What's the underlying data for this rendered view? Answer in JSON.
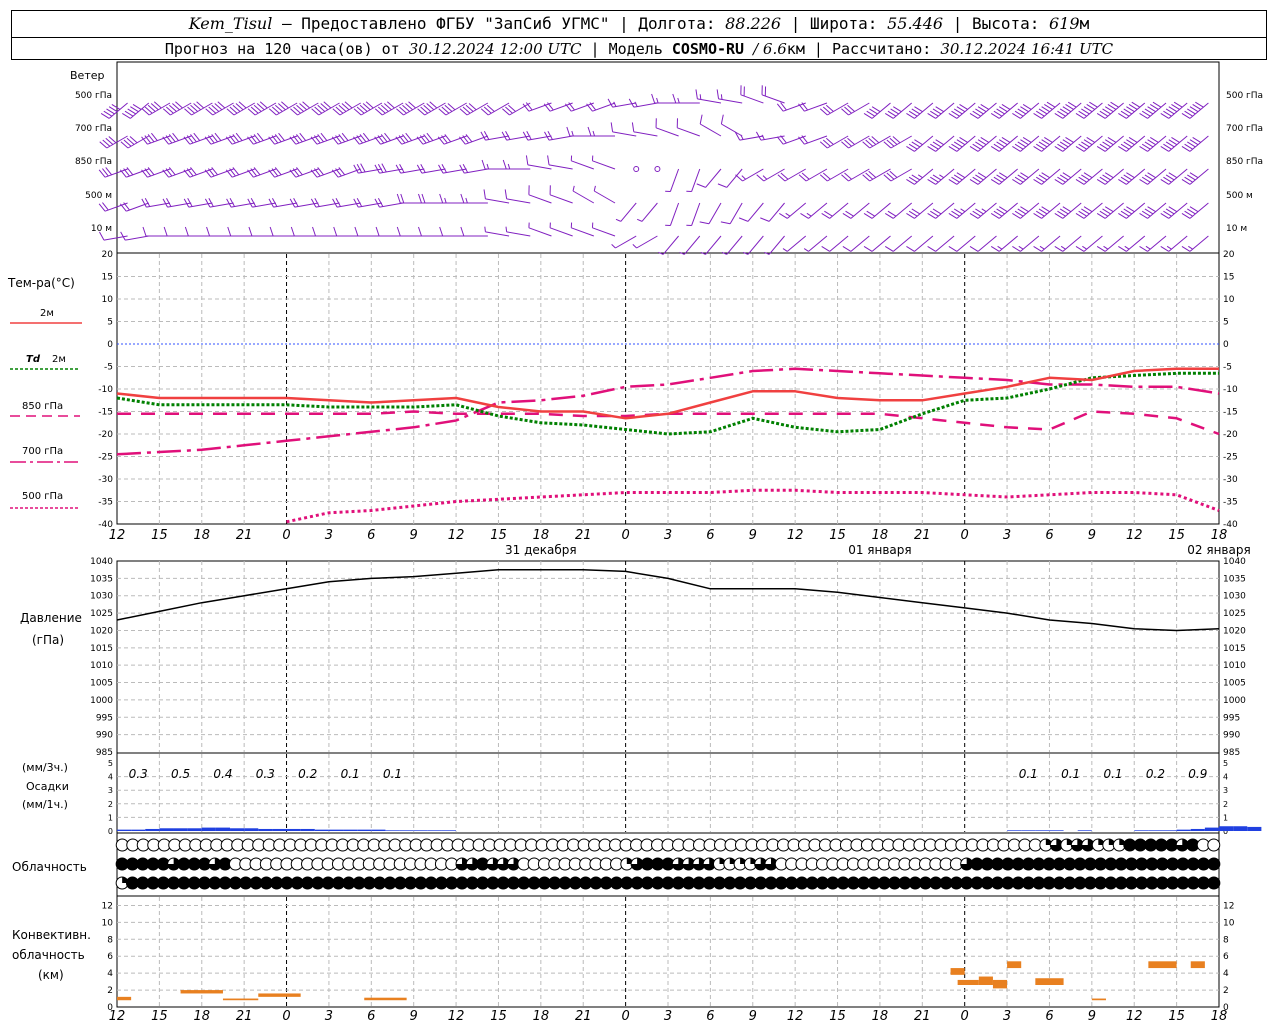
{
  "header": {
    "station": "Kem_Tisul",
    "provider": "— Предоставлено ФГБУ \"ЗапСиб УГМС\"",
    "lon_label": "| Долгота:",
    "lon": "88.226",
    "lat_label": "| Широта:",
    "lat": "55.446",
    "alt_label": "| Высота:",
    "alt": "619",
    "alt_unit": "м",
    "forecast_label": "Прогноз на 120 часа(ов) от",
    "init_time": "30.12.2024 12:00 UTC",
    "model_label": "| Модель",
    "model": "COSMO-RU",
    "resolution": "/ 6.6",
    "res_unit": "км |",
    "calc_label": "Рассчитано:",
    "calc_time": "30.12.2024 16:41 UTC"
  },
  "labels": {
    "wind": "Ветер",
    "wind_levels": [
      "500 гПа",
      "700 гПа",
      "850 гПа",
      "500 м",
      "10 м"
    ],
    "temp_title": "Тем-ра(°С)",
    "t2m": "2м",
    "td_sym": "Td",
    "td_lvl": "2м",
    "t850": "850 гПа",
    "t700": "700 гПа",
    "t500": "500 гПа",
    "pressure": "Давление",
    "pressure_unit": "(гПа)",
    "precip_3h": "(мм/3ч.)",
    "precip": "Осадки",
    "precip_1h": "(мм/1ч.)",
    "clouds": "Облачность",
    "conv1": "Конвективн.",
    "conv2": "облачность",
    "conv3": "(км)"
  },
  "x_ticks": [
    "12",
    "15",
    "18",
    "21",
    "0",
    "3",
    "6",
    "9",
    "12",
    "15",
    "18",
    "21",
    "0",
    "3",
    "6",
    "9",
    "12",
    "15",
    "18",
    "21",
    "0",
    "3",
    "6",
    "9",
    "12",
    "15",
    "18"
  ],
  "day_labels": [
    {
      "hour": 24,
      "text": "31 декабря"
    },
    {
      "hour": 48,
      "text": "01 января"
    },
    {
      "hour": 72,
      "text": "02 января"
    }
  ],
  "colors": {
    "t2m": "#f04040",
    "td2m": "#008000",
    "t850": "#e0107a",
    "t700": "#e0107a",
    "t500": "#e0107a",
    "wind": "#8020c0",
    "precip": "#2040e0",
    "conv": "#e88020",
    "zero": "#3050ff"
  },
  "chart_data": [
    {
      "type": "line",
      "panel": "temperature",
      "ylim": [
        -40,
        20
      ],
      "y_ticks": [
        20,
        15,
        10,
        5,
        0,
        -5,
        -10,
        -15,
        -20,
        -25,
        -30,
        -35,
        -40
      ],
      "hours": [
        0,
        3,
        6,
        9,
        12,
        15,
        18,
        21,
        24,
        27,
        30,
        33,
        36,
        39,
        42,
        45,
        48,
        51,
        54,
        57,
        60,
        63,
        66,
        69,
        72,
        75,
        78
      ],
      "series": [
        {
          "name": "2м",
          "values": [
            -11,
            -12,
            -12,
            -12,
            -12,
            -12.5,
            -13,
            -12.5,
            -12,
            -14,
            -15,
            -15,
            -16.5,
            -15.5,
            -13,
            -10.5,
            -10.5,
            -12,
            -12.5,
            -12.5,
            -11,
            -9.5,
            -7.5,
            -8,
            -6,
            -5.5,
            -5.5
          ]
        },
        {
          "name": "Td 2м",
          "values": [
            -12,
            -13.5,
            -13.5,
            -13.5,
            -13.5,
            -14,
            -14,
            -14,
            -13.5,
            -16,
            -17.5,
            -18,
            -19,
            -20,
            -19.5,
            -16.5,
            -18.5,
            -19.5,
            -19,
            -15.5,
            -12.5,
            -12,
            -10,
            -7.5,
            -7,
            -6.5,
            -6.5
          ]
        },
        {
          "name": "850 гПа",
          "values": [
            -15.5,
            -15.5,
            -15.5,
            -15.5,
            -15.5,
            -15.5,
            -15.5,
            -15,
            -15.5,
            -15.5,
            -15.5,
            -16,
            -16,
            -15.5,
            -15.5,
            -15.5,
            -15.5,
            -15.5,
            -15.5,
            -16.5,
            -17.5,
            -18.5,
            -19,
            -15,
            -15.5,
            -16.5,
            -20
          ]
        },
        {
          "name": "700 гПа",
          "values": [
            -24.5,
            -24,
            -23.5,
            -22.5,
            -21.5,
            -20.5,
            -19.5,
            -18.5,
            -17,
            -13,
            -12.5,
            -11.5,
            -9.5,
            -9,
            -7.5,
            -6,
            -5.5,
            -6,
            -6.5,
            -7,
            -7.5,
            -8,
            -9,
            -9,
            -9.5,
            -9.5,
            -11
          ]
        },
        {
          "name": "500 гПа",
          "values": [
            null,
            null,
            null,
            null,
            -39.5,
            -37.5,
            -37,
            -36,
            -35,
            -34.5,
            -34,
            -33.5,
            -33,
            -33,
            -33,
            -32.5,
            -32.5,
            -33,
            -33,
            -33,
            -33.5,
            -34,
            -33.5,
            -33,
            -33,
            -33.5,
            -37
          ]
        }
      ]
    },
    {
      "type": "line",
      "panel": "pressure",
      "ylim": [
        985,
        1040
      ],
      "y_ticks": [
        1040,
        1035,
        1030,
        1025,
        1020,
        1015,
        1010,
        1005,
        1000,
        995,
        990,
        985
      ],
      "hours": [
        0,
        3,
        6,
        9,
        12,
        15,
        18,
        21,
        24,
        27,
        30,
        33,
        36,
        39,
        42,
        45,
        48,
        51,
        54,
        57,
        60,
        63,
        66,
        69,
        72,
        75,
        78
      ],
      "series": [
        {
          "name": "Давление",
          "values": [
            1023,
            1025.5,
            1028,
            1030,
            1032,
            1034,
            1035,
            1035.5,
            1036.5,
            1037.5,
            1037.5,
            1037.5,
            1037,
            1035,
            1032,
            1032,
            1032,
            1031,
            1029.5,
            1028,
            1026.5,
            1025,
            1023,
            1022,
            1020.5,
            1020,
            1020.5
          ]
        }
      ]
    },
    {
      "type": "bar",
      "panel": "precipitation",
      "ylim": [
        0,
        5
      ],
      "y_ticks": [
        5,
        4,
        3,
        2,
        1,
        0
      ],
      "labels_3h": [
        {
          "hour": 1.5,
          "text": "0.3"
        },
        {
          "hour": 4.5,
          "text": "0.5"
        },
        {
          "hour": 7.5,
          "text": "0.4"
        },
        {
          "hour": 10.5,
          "text": "0.3"
        },
        {
          "hour": 13.5,
          "text": "0.2"
        },
        {
          "hour": 16.5,
          "text": "0.1"
        },
        {
          "hour": 19.5,
          "text": "0.1"
        },
        {
          "hour": 64.5,
          "text": "0.1"
        },
        {
          "hour": 67.5,
          "text": "0.1"
        },
        {
          "hour": 70.5,
          "text": "0.1"
        },
        {
          "hour": 73.5,
          "text": "0.2"
        },
        {
          "hour": 76.5,
          "text": "0.9"
        }
      ],
      "hourly": [
        0.1,
        0.1,
        0.15,
        0.2,
        0.2,
        0.2,
        0.25,
        0.25,
        0.2,
        0.2,
        0.15,
        0.15,
        0.15,
        0.15,
        0.1,
        0.1,
        0.1,
        0.1,
        0.1,
        0.05,
        0.05,
        0.05,
        0.05,
        0.05,
        0,
        0,
        0,
        0,
        0,
        0,
        0,
        0,
        0,
        0,
        0,
        0,
        0,
        0,
        0,
        0,
        0,
        0,
        0,
        0,
        0,
        0,
        0,
        0,
        0,
        0,
        0,
        0,
        0,
        0,
        0,
        0,
        0,
        0,
        0,
        0,
        0,
        0,
        0,
        0.05,
        0.05,
        0.05,
        0.05,
        0,
        0.05,
        0,
        0,
        0,
        0.05,
        0.05,
        0.05,
        0.1,
        0.15,
        0.25,
        0.35,
        0.35,
        0.3
      ]
    },
    {
      "type": "bar",
      "panel": "convective_clouds",
      "ylim": [
        0,
        13
      ],
      "y_ticks": [
        12,
        10,
        8,
        6,
        4,
        2,
        0
      ],
      "segments": [
        {
          "h0": 0,
          "h1": 1,
          "base": 0.8,
          "top": 1.2
        },
        {
          "h0": 4.5,
          "h1": 7.5,
          "base": 1.6,
          "top": 2.0
        },
        {
          "h0": 7.5,
          "h1": 10,
          "base": 0.8,
          "top": 1.0
        },
        {
          "h0": 10,
          "h1": 13,
          "base": 1.2,
          "top": 1.6
        },
        {
          "h0": 17.5,
          "h1": 20.5,
          "base": 0.8,
          "top": 1.1
        },
        {
          "h0": 59,
          "h1": 60,
          "base": 3.8,
          "top": 4.6
        },
        {
          "h0": 59.5,
          "h1": 61,
          "base": 2.6,
          "top": 3.2
        },
        {
          "h0": 61,
          "h1": 62,
          "base": 2.6,
          "top": 3.6
        },
        {
          "h0": 62,
          "h1": 63,
          "base": 2.2,
          "top": 3.2
        },
        {
          "h0": 63,
          "h1": 64,
          "base": 4.6,
          "top": 5.4
        },
        {
          "h0": 65,
          "h1": 67,
          "base": 2.6,
          "top": 3.4
        },
        {
          "h0": 69,
          "h1": 70,
          "base": 0.8,
          "top": 1.0
        },
        {
          "h0": 73,
          "h1": 75,
          "base": 4.6,
          "top": 5.4
        },
        {
          "h0": 76,
          "h1": 77,
          "base": 4.6,
          "top": 5.4
        }
      ]
    },
    {
      "type": "table",
      "panel": "cloud_cover",
      "rows": [
        [
          0,
          0,
          0,
          0,
          0,
          0,
          0,
          0,
          0,
          0,
          0,
          0,
          0,
          0,
          0,
          0,
          0,
          0,
          0,
          0,
          0,
          0,
          0,
          0,
          0,
          0,
          0,
          0,
          0,
          0,
          0,
          0,
          0,
          0,
          0,
          0,
          0,
          0,
          0,
          0,
          0,
          0,
          0,
          0,
          0,
          0,
          0,
          0,
          0,
          0,
          0,
          0,
          0,
          0,
          0,
          0,
          0,
          0,
          0,
          0,
          0,
          0,
          0,
          0,
          0,
          0,
          0,
          0,
          0,
          0,
          0,
          0,
          0,
          0,
          0,
          0,
          0,
          0,
          0,
          0,
          0,
          0,
          0,
          0,
          0,
          0,
          0,
          0,
          2,
          3,
          2,
          3,
          3,
          2,
          2,
          2,
          4,
          4,
          4,
          4,
          4,
          3,
          4,
          0,
          0
        ],
        [
          4,
          4,
          4,
          4,
          4,
          3,
          4,
          4,
          4,
          3,
          4,
          0,
          0,
          0,
          0,
          0,
          0,
          0,
          0,
          0,
          0,
          0,
          0,
          0,
          0,
          0,
          0,
          0,
          0,
          0,
          0,
          0,
          0,
          3,
          3,
          4,
          3,
          3,
          3,
          0,
          0,
          0,
          0,
          0,
          0,
          0,
          0,
          0,
          0,
          2,
          3,
          4,
          4,
          4,
          3,
          3,
          3,
          3,
          2,
          2,
          2,
          2,
          3,
          3,
          0,
          0,
          0,
          0,
          0,
          0,
          0,
          0,
          0,
          0,
          0,
          0,
          0,
          0,
          0,
          0,
          0,
          0,
          3,
          4,
          4,
          4,
          4,
          4,
          4,
          4,
          4,
          4,
          4,
          4,
          4,
          4,
          4,
          4,
          4,
          4,
          4,
          4,
          4,
          4,
          4,
          4,
          4
        ],
        [
          2,
          4,
          4,
          4,
          4,
          4,
          4,
          4,
          4,
          4,
          4,
          4,
          4,
          4,
          4,
          4,
          4,
          4,
          4,
          4,
          4,
          4,
          4,
          4,
          4,
          4,
          4,
          4,
          4,
          4,
          4,
          4,
          4,
          4,
          4,
          4,
          4,
          4,
          4,
          4,
          4,
          4,
          4,
          4,
          4,
          4,
          4,
          4,
          4,
          4,
          4,
          4,
          4,
          4,
          4,
          4,
          4,
          4,
          4,
          4,
          4,
          4,
          4,
          4,
          4,
          4,
          4,
          4,
          4,
          4,
          4,
          4,
          4,
          4,
          4,
          4,
          4,
          4,
          4,
          4,
          4,
          4,
          4,
          4,
          4,
          4,
          4,
          4,
          4,
          4,
          4,
          4,
          4,
          4,
          4,
          4,
          4,
          4,
          4,
          4,
          4,
          4,
          4,
          4,
          4,
          4,
          4
        ]
      ]
    },
    {
      "type": "scatter",
      "panel": "wind",
      "levels": [
        "500 гПа",
        "700 гПа",
        "850 гПа",
        "500 м",
        "10 м"
      ],
      "direction_deg": [
        [
          230,
          240,
          240,
          240,
          240,
          240,
          240,
          240,
          240,
          240,
          250,
          250,
          260,
          270,
          280,
          290,
          250,
          240,
          230,
          230,
          230,
          230,
          230,
          230,
          230,
          230,
          230
        ],
        [
          240,
          250,
          250,
          250,
          250,
          250,
          250,
          250,
          250,
          260,
          260,
          270,
          280,
          290,
          300,
          260,
          250,
          240,
          240,
          230,
          230,
          230,
          230,
          230,
          230,
          230,
          230
        ],
        [
          250,
          250,
          250,
          250,
          250,
          250,
          260,
          260,
          260,
          270,
          280,
          290,
          0,
          200,
          220,
          240,
          240,
          240,
          240,
          230,
          230,
          230,
          230,
          230,
          230,
          230,
          230
        ],
        [
          250,
          260,
          260,
          260,
          260,
          260,
          260,
          270,
          270,
          280,
          290,
          300,
          220,
          200,
          210,
          220,
          230,
          230,
          230,
          230,
          230,
          230,
          230,
          230,
          230,
          230,
          230
        ],
        [
          260,
          270,
          270,
          270,
          270,
          270,
          270,
          270,
          270,
          280,
          290,
          290,
          240,
          220,
          220,
          220,
          230,
          230,
          230,
          230,
          230,
          230,
          230,
          230,
          230,
          230,
          230
        ]
      ],
      "speed_ms": [
        [
          25,
          25,
          25,
          25,
          25,
          25,
          25,
          25,
          20,
          15,
          12,
          10,
          8,
          8,
          8,
          10,
          12,
          15,
          20,
          22,
          25,
          27,
          30,
          30,
          30,
          30,
          30
        ],
        [
          20,
          20,
          20,
          20,
          20,
          20,
          20,
          20,
          15,
          12,
          10,
          8,
          6,
          6,
          6,
          8,
          12,
          15,
          20,
          22,
          25,
          25,
          25,
          25,
          25,
          25,
          25
        ],
        [
          15,
          15,
          15,
          15,
          15,
          15,
          15,
          12,
          10,
          8,
          6,
          4,
          0,
          4,
          6,
          8,
          10,
          12,
          15,
          18,
          20,
          20,
          20,
          20,
          20,
          20,
          20
        ],
        [
          12,
          12,
          12,
          12,
          12,
          12,
          12,
          10,
          8,
          6,
          5,
          4,
          3,
          4,
          5,
          7,
          9,
          10,
          12,
          15,
          18,
          20,
          20,
          20,
          20,
          20,
          20
        ],
        [
          5,
          5,
          5,
          5,
          5,
          5,
          5,
          5,
          5,
          4,
          4,
          3,
          3,
          3,
          3,
          4,
          4,
          5,
          5,
          6,
          7,
          8,
          8,
          8,
          8,
          8,
          8
        ]
      ]
    }
  ]
}
